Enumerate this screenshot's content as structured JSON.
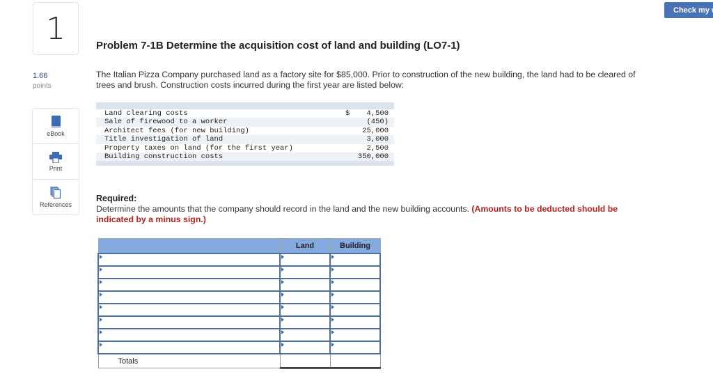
{
  "question": {
    "number": "1",
    "points_value": "1.66",
    "points_label": "points"
  },
  "tools": [
    {
      "label": "eBook",
      "icon": "book-icon"
    },
    {
      "label": "Print",
      "icon": "printer-icon"
    },
    {
      "label": "References",
      "icon": "references-icon"
    }
  ],
  "header": {
    "check_button": "Check my work"
  },
  "problem": {
    "title": "Problem 7-1B Determine the acquisition cost of land and building (LO7-1)",
    "intro": "The Italian Pizza Company purchased land as a factory site for $85,000. Prior to construction of the new building, the land had to be cleared of trees and brush. Construction costs incurred during the first year are listed below:"
  },
  "costs": [
    {
      "desc": "Land clearing costs",
      "currency": "$",
      "amount": "4,500"
    },
    {
      "desc": "Sale of firewood to a worker",
      "currency": "",
      "amount": "(450)"
    },
    {
      "desc": "Architect fees (for new building)",
      "currency": "",
      "amount": "25,000"
    },
    {
      "desc": "Title investigation of land",
      "currency": "",
      "amount": "3,000"
    },
    {
      "desc": "Property taxes on land (for the first year)",
      "currency": "",
      "amount": "2,500"
    },
    {
      "desc": "Building construction costs",
      "currency": "",
      "amount": "350,000"
    }
  ],
  "required": {
    "heading": "Required:",
    "text": "Determine the amounts that the company should record in the land and the new building accounts.",
    "note": "(Amounts to be deducted should be indicated by a minus sign.)"
  },
  "answer_table": {
    "headers": [
      "",
      "Land",
      "Building"
    ],
    "row_count": 8,
    "totals_label": "Totals"
  },
  "colors": {
    "accent": "#4a73b5",
    "header_fill": "#83a9df",
    "cell_border": "#4e6f9c",
    "note_red": "#b0231f"
  }
}
